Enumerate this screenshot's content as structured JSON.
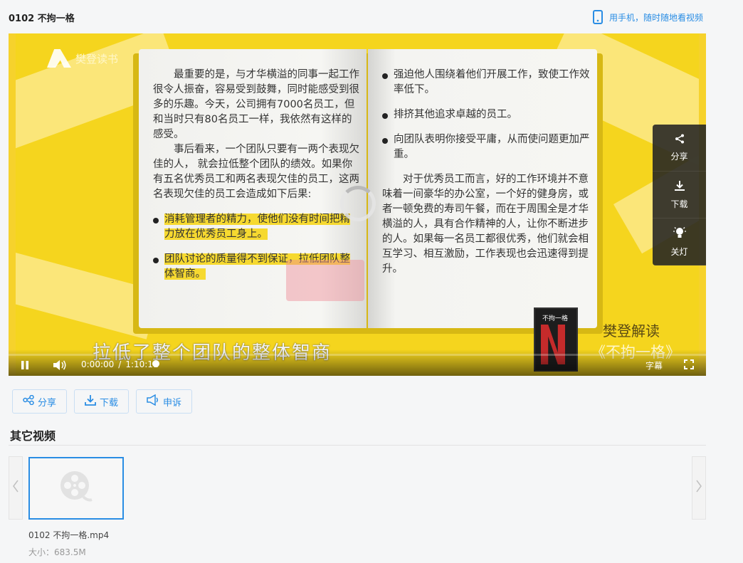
{
  "page": {
    "title": "0102 不拘一格",
    "mobile_link": "用手机，随时随地看视频"
  },
  "player": {
    "logo_text": "樊登读书",
    "left_page": {
      "para1": "最重要的是，与才华横溢的同事一起工作很令人振奋，容易受到鼓舞，同时能感受到很多的乐趣。今天，公司拥有7000名员工，但和当时只有80名员工一样，我依然有这样的感受。",
      "para2": "事后看来，一个团队只要有一两个表现欠佳的人， 就会拉低整个团队的绩效。如果你有五名优秀员工和两名表现欠佳的员工，这两名表现欠佳的员工会造成如下后果:",
      "bullet1": "消耗管理者的精力，使他们没有时间把精力放在优秀员工身上。",
      "bullet2": "团队讨论的质量得不到保证，拉低团队整体智商。"
    },
    "right_page": {
      "bullet1": "强迫他人围绕着他们开展工作，致使工作效率低下。",
      "bullet2": "排挤其他追求卓越的员工。",
      "bullet3": "向团队表明你接受平庸，从而使问题更加严重。",
      "para": "对于优秀员工而言，好的工作环境并不意味着一间豪华的办公室，一个好的健身房，或者一顿免费的寿司午餐，而在于周围全是才华横溢的人，具有合作精神的人，让你不断进步的人。如果每一名员工都很优秀，他们就会相互学习、相互激励，工作表现也会迅速得到提升。"
    },
    "book_cover_title": "不拘一格",
    "interp_label": "樊登解读",
    "interp_book": "《不拘一格》",
    "subtitle": "拉低了整个团队的整体智商",
    "current_time": "0:00:00",
    "time_separator": "/",
    "duration": "1:10:11",
    "progress": 0,
    "captions_label": "字幕",
    "side_menu": {
      "share": "分享",
      "download": "下载",
      "lights_off": "关灯"
    }
  },
  "actions": {
    "share": "分享",
    "download": "下载",
    "report": "申诉"
  },
  "other_videos": {
    "title": "其它视频",
    "items": [
      {
        "name": "0102 不拘一格.mp4",
        "size": "大小：683.5M"
      }
    ]
  },
  "colors": {
    "accent": "#2a8de4",
    "player_bg": "#f5d51e",
    "highlight": "#f6d930"
  }
}
